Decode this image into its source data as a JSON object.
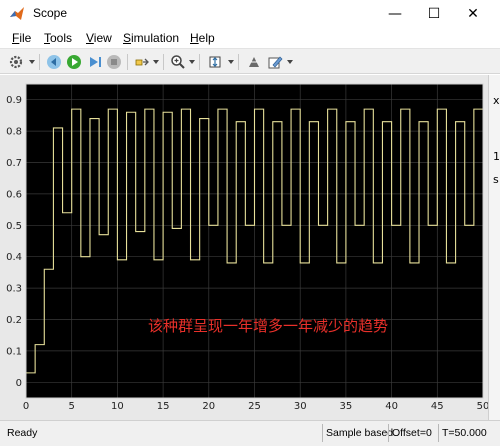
{
  "window": {
    "title": "Scope",
    "minimize_glyph": "—",
    "maximize_glyph": "☐",
    "close_glyph": "✕"
  },
  "menu": {
    "items": [
      {
        "label": "File",
        "accel": "F",
        "rest": "ile"
      },
      {
        "label": "Tools",
        "accel": "T",
        "rest": "ools"
      },
      {
        "label": "View",
        "accel": "V",
        "rest": "iew"
      },
      {
        "label": "Simulation",
        "accel": "S",
        "rest": "imulation"
      },
      {
        "label": "Help",
        "accel": "H",
        "rest": "elp"
      }
    ]
  },
  "toolbar": {
    "icons": [
      "settings-icon",
      "stepback-icon",
      "run-icon",
      "step-forward-icon",
      "stop-icon",
      "highlight-icon",
      "zoom-in-icon",
      "autoscale-icon",
      "cursor-icon",
      "edit-icon"
    ]
  },
  "status": {
    "ready": "Ready",
    "mode": "Sample based",
    "offset": "Offset=0",
    "time": "T=50.000"
  },
  "side_fragments": [
    "x",
    "1",
    "s"
  ],
  "annotation": "该种群呈现一年增多一年减少的趋势",
  "colors": {
    "plot_bg": "#000000",
    "axis": "#cfcfcf",
    "grid": "#3a3a3a",
    "signal": "#e7e09a",
    "annotation": "#e8302a"
  },
  "chart_data": {
    "type": "line",
    "step": true,
    "xlim": [
      0,
      50
    ],
    "ylim": [
      -0.05,
      0.95
    ],
    "xticks": [
      0,
      5,
      10,
      15,
      20,
      25,
      30,
      35,
      40,
      45,
      50
    ],
    "yticks": [
      0,
      0.1,
      0.2,
      0.3,
      0.4,
      0.5,
      0.6,
      0.7,
      0.8,
      0.9
    ],
    "ytick_labels": [
      "0",
      "0.1",
      "0.2",
      "0.3",
      "0.4",
      "0.5",
      "0.6",
      "0.7",
      "0.8",
      "0.9"
    ],
    "grid": true,
    "series": [
      {
        "x": [
          0,
          1,
          2,
          3,
          4,
          5,
          6,
          7,
          8,
          9,
          10,
          11,
          12,
          13,
          14,
          15,
          16,
          17,
          18,
          19,
          20,
          21,
          22,
          23,
          24,
          25,
          26,
          27,
          28,
          29,
          30,
          31,
          32,
          33,
          34,
          35,
          36,
          37,
          38,
          39,
          40,
          41,
          42,
          43,
          44,
          45,
          46,
          47,
          48,
          49,
          50
        ],
        "values": [
          0.03,
          0.12,
          0.36,
          0.81,
          0.54,
          0.87,
          0.4,
          0.84,
          0.47,
          0.87,
          0.39,
          0.86,
          0.48,
          0.87,
          0.39,
          0.86,
          0.49,
          0.87,
          0.39,
          0.84,
          0.5,
          0.87,
          0.38,
          0.83,
          0.5,
          0.87,
          0.38,
          0.83,
          0.5,
          0.87,
          0.38,
          0.83,
          0.5,
          0.87,
          0.38,
          0.83,
          0.5,
          0.87,
          0.38,
          0.83,
          0.5,
          0.87,
          0.38,
          0.83,
          0.5,
          0.87,
          0.38,
          0.83,
          0.5,
          0.87,
          0.87
        ]
      }
    ]
  }
}
